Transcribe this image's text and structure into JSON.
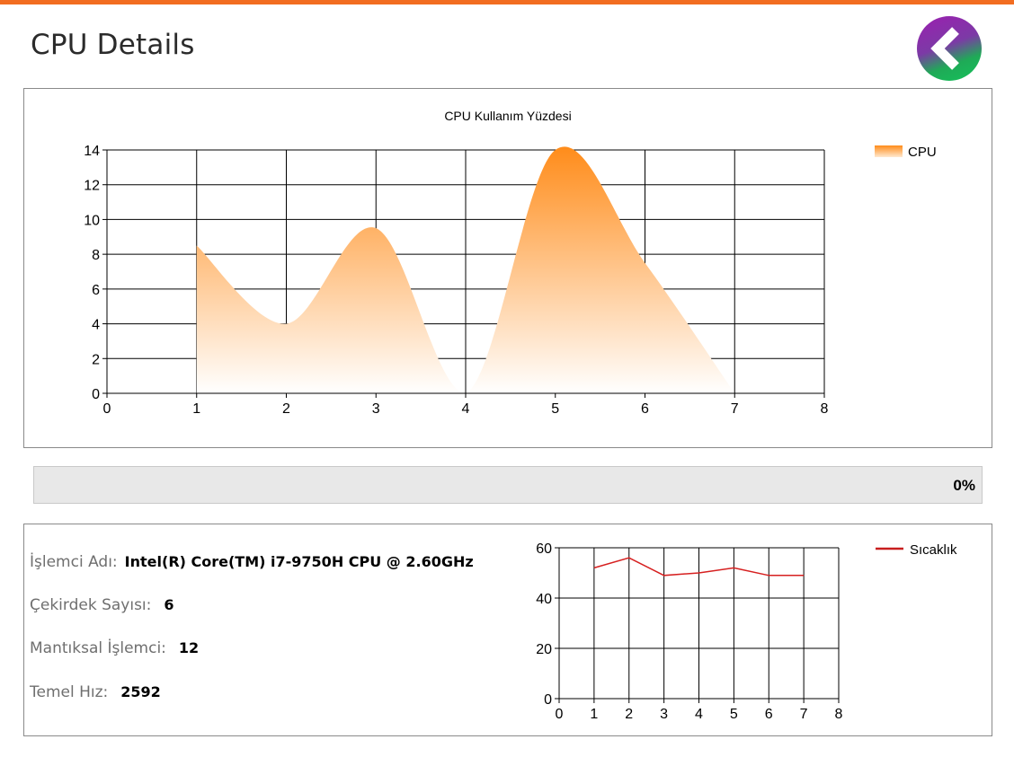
{
  "window": {
    "title": "CPU Details"
  },
  "colors": {
    "accent": "#f26d21",
    "cpu_series": "#ff8c1a",
    "temp_series": "#d62020"
  },
  "icons": {
    "back": "chevron-left-icon"
  },
  "progress": {
    "value_percent": 0,
    "text": "0%"
  },
  "info": {
    "processor_name_label": "İşlemci Adı:",
    "processor_name_value": "Intel(R) Core(TM) i7-9750H CPU @ 2.60GHz",
    "core_count_label": "Çekirdek Sayısı:",
    "core_count_value": "6",
    "logical_processor_label": "Mantıksal İşlemci:",
    "logical_processor_value": "12",
    "base_speed_label": "Temel Hız:",
    "base_speed_value": "2592"
  },
  "chart_data": [
    {
      "type": "area",
      "title": "CPU Kullanım Yüzdesi",
      "xlim": [
        0,
        8
      ],
      "ylim": [
        0,
        14
      ],
      "xticks": [
        0,
        1,
        2,
        3,
        4,
        5,
        6,
        7,
        8
      ],
      "yticks": [
        0,
        2,
        4,
        6,
        8,
        10,
        12,
        14
      ],
      "grid": true,
      "legend": "top-right",
      "series": [
        {
          "name": "CPU",
          "x": [
            1,
            2,
            3,
            4,
            5,
            6,
            7
          ],
          "values": [
            8.5,
            4,
            9.5,
            0,
            14,
            7.5,
            0
          ]
        }
      ]
    },
    {
      "type": "line",
      "xlim": [
        0,
        8
      ],
      "ylim": [
        0,
        60
      ],
      "xticks": [
        0,
        1,
        2,
        3,
        4,
        5,
        6,
        7,
        8
      ],
      "yticks": [
        0,
        20,
        40,
        60
      ],
      "grid": true,
      "legend": "top-right",
      "series": [
        {
          "name": "Sıcaklık",
          "x": [
            1,
            2,
            3,
            4,
            5,
            6,
            7
          ],
          "values": [
            52,
            56,
            49,
            50,
            52,
            49,
            49
          ]
        }
      ]
    }
  ]
}
